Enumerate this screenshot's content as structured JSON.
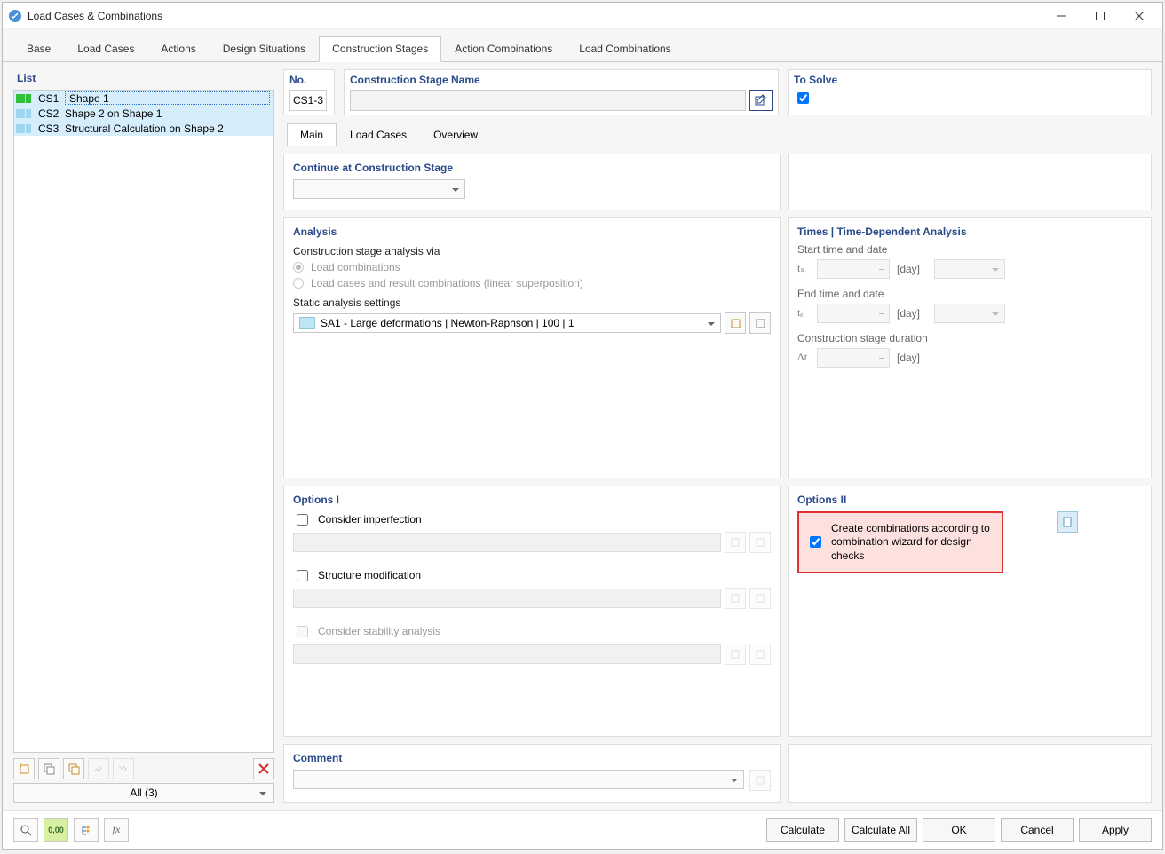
{
  "window": {
    "title": "Load Cases & Combinations"
  },
  "tabs": [
    "Base",
    "Load Cases",
    "Actions",
    "Design Situations",
    "Construction Stages",
    "Action Combinations",
    "Load Combinations"
  ],
  "activeTab": 4,
  "list": {
    "header": "List",
    "items": [
      {
        "code": "CS1",
        "name": "Shape 1"
      },
      {
        "code": "CS2",
        "name": "Shape 2 on Shape 1"
      },
      {
        "code": "CS3",
        "name": "Structural Calculation on Shape 2"
      }
    ],
    "filter": "All (3)"
  },
  "header": {
    "no_label": "No.",
    "no_value": "CS1-3",
    "name_label": "Construction Stage Name",
    "solve_label": "To Solve"
  },
  "subtabs": [
    "Main",
    "Load Cases",
    "Overview"
  ],
  "activeSubTab": 0,
  "continue": {
    "title": "Continue at Construction Stage"
  },
  "analysis": {
    "title": "Analysis",
    "via_label": "Construction stage analysis via",
    "opt1": "Load combinations",
    "opt2": "Load cases and result combinations (linear superposition)",
    "sa_label": "Static analysis settings",
    "sa_value": "SA1 - Large deformations | Newton-Raphson | 100 | 1"
  },
  "times": {
    "title": "Times | Time-Dependent Analysis",
    "start": "Start time and date",
    "ts": "tₛ",
    "end": "End time and date",
    "te": "tₑ",
    "dur": "Construction stage duration",
    "dt": "Δt",
    "unit": "[day]"
  },
  "options1": {
    "title": "Options I",
    "imperf": "Consider imperfection",
    "struct": "Structure modification",
    "stab": "Consider stability analysis"
  },
  "options2": {
    "title": "Options II",
    "create": "Create combinations according to combination wizard for design checks"
  },
  "comment": {
    "title": "Comment"
  },
  "buttons": {
    "calc": "Calculate",
    "calc_all": "Calculate All",
    "ok": "OK",
    "cancel": "Cancel",
    "apply": "Apply"
  }
}
